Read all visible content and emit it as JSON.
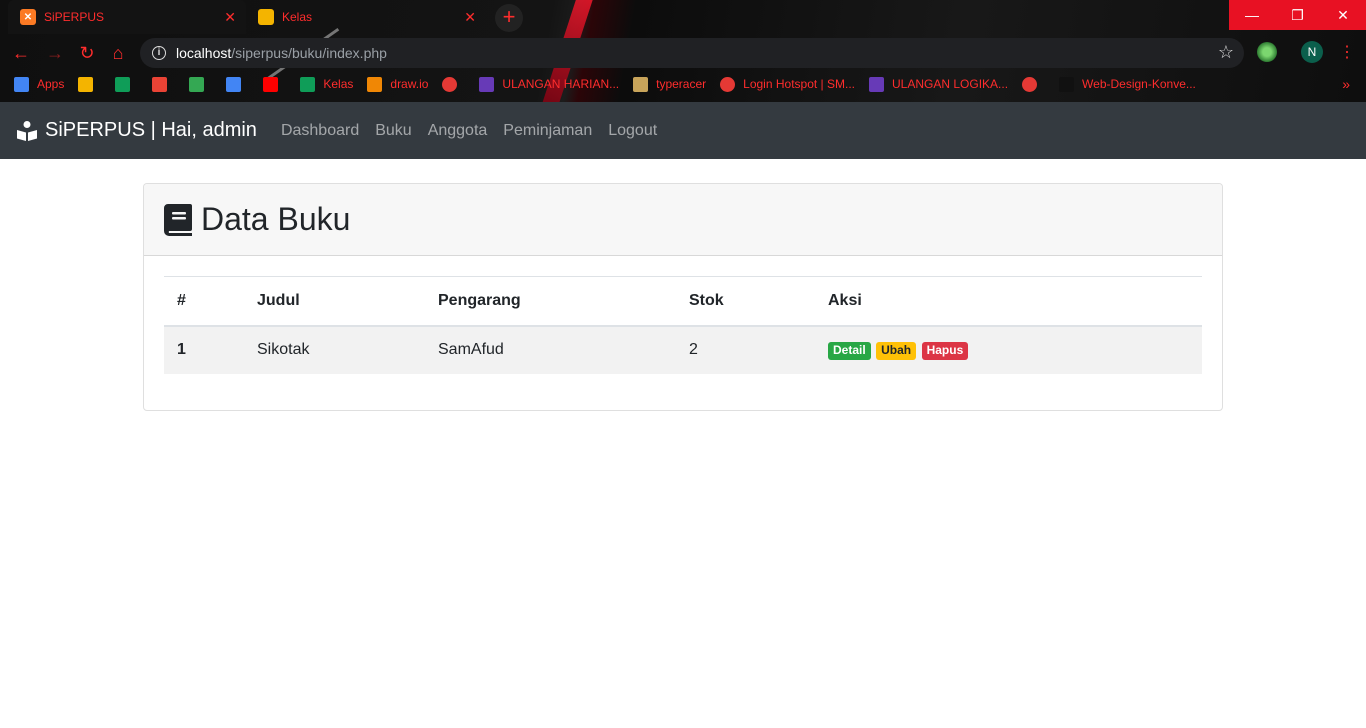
{
  "browser": {
    "tabs": [
      {
        "title": "SiPERPUS",
        "active": true,
        "favicon_color": "#fb7a24"
      },
      {
        "title": "Kelas",
        "active": false,
        "favicon_color": "#f4b400"
      }
    ],
    "address": {
      "host": "localhost",
      "path": "/siperpus/buku/index.php"
    },
    "profile_initial": "N",
    "bookmarks": [
      {
        "label": "Apps",
        "icon": "apps-grid-icon",
        "color": "#4285f4"
      },
      {
        "label": "",
        "icon": "slides-icon",
        "color": "#f4b400"
      },
      {
        "label": "",
        "icon": "classroom-icon",
        "color": "#0f9d58"
      },
      {
        "label": "",
        "icon": "gmail-icon",
        "color": "#ea4335"
      },
      {
        "label": "",
        "icon": "drive-icon",
        "color": "#34a853"
      },
      {
        "label": "",
        "icon": "docs-icon",
        "color": "#4285f4"
      },
      {
        "label": "",
        "icon": "youtube-icon",
        "color": "#ff0000"
      },
      {
        "label": "Kelas",
        "icon": "classroom-icon",
        "color": "#0f9d58"
      },
      {
        "label": "draw.io",
        "icon": "drawio-icon",
        "color": "#f08705"
      },
      {
        "label": "",
        "icon": "globe-icon",
        "color": "#e53935"
      },
      {
        "label": "ULANGAN HARIAN...",
        "icon": "forms-icon",
        "color": "#673ab7"
      },
      {
        "label": "typeracer",
        "icon": "typeracer-icon",
        "color": "#c8a45a"
      },
      {
        "label": "Login Hotspot | SM...",
        "icon": "globe-icon",
        "color": "#e53935"
      },
      {
        "label": "ULANGAN LOGIKA...",
        "icon": "forms-icon",
        "color": "#673ab7"
      },
      {
        "label": "",
        "icon": "globe-icon",
        "color": "#e53935"
      },
      {
        "label": "Web-Design-Konve...",
        "icon": "github-icon",
        "color": "#111111"
      }
    ],
    "more_bookmarks": "»"
  },
  "navbar": {
    "brand": "SiPERPUS | Hai, admin",
    "links": [
      "Dashboard",
      "Buku",
      "Anggota",
      "Peminjaman",
      "Logout"
    ]
  },
  "page": {
    "title": "Data Buku",
    "table": {
      "columns": [
        "#",
        "Judul",
        "Pengarang",
        "Stok",
        "Aksi"
      ],
      "rows": [
        {
          "no": "1",
          "judul": "Sikotak",
          "pengarang": "SamAfud",
          "stok": "2"
        }
      ],
      "actions": {
        "detail": "Detail",
        "ubah": "Ubah",
        "hapus": "Hapus"
      }
    }
  },
  "colors": {
    "navbar_bg": "#343a40",
    "accent_red": "#ff2d2d",
    "success": "#28a745",
    "warning": "#ffc107",
    "danger": "#dc3545"
  }
}
